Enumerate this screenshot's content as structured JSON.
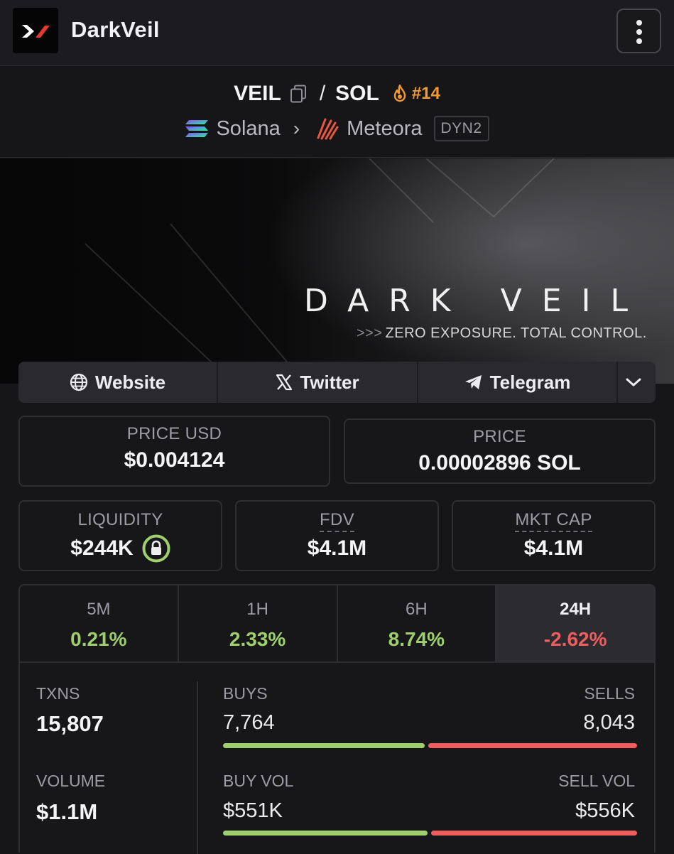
{
  "app": {
    "title": "DarkVeil"
  },
  "pair": {
    "base": "VEIL",
    "separator": "/",
    "quote": "SOL",
    "rank": "#14",
    "chain": "Solana",
    "dex": "Meteora",
    "pool_type": "DYN2"
  },
  "banner": {
    "title": "DARK VEIL",
    "tagline_arrows": ">>>",
    "tagline": "ZERO EXPOSURE. TOTAL CONTROL."
  },
  "links": {
    "website": "Website",
    "twitter": "Twitter",
    "telegram": "Telegram"
  },
  "prices": {
    "usd_label": "PRICE USD",
    "usd_value": "$0.004124",
    "native_label": "PRICE",
    "native_value": "0.00002896 SOL"
  },
  "metrics": {
    "liquidity_label": "LIQUIDITY",
    "liquidity_value": "$244K",
    "fdv_label": "FDV",
    "fdv_value": "$4.1M",
    "mktcap_label": "MKT CAP",
    "mktcap_value": "$4.1M"
  },
  "timeframes": [
    {
      "label": "5M",
      "change": "0.21%"
    },
    {
      "label": "1H",
      "change": "2.33%"
    },
    {
      "label": "6H",
      "change": "8.74%"
    },
    {
      "label": "24H",
      "change": "-2.62%"
    }
  ],
  "selected_timeframe": "24H",
  "txns": {
    "txns_label": "TXNS",
    "txns_value": "15,807",
    "buys_label": "BUYS",
    "buys_value": "7,764",
    "sells_label": "SELLS",
    "sells_value": "8,043",
    "buy_share": 0.491,
    "volume_label": "VOLUME",
    "volume_value": "$1.1M",
    "buy_vol_label": "BUY VOL",
    "buy_vol_value": "$551K",
    "sell_vol_label": "SELL VOL",
    "sell_vol_value": "$556K",
    "buy_vol_share": 0.498
  },
  "colors": {
    "positive": "#9fcf6c",
    "negative": "#ef5d5d",
    "rank": "#f59a2c"
  }
}
